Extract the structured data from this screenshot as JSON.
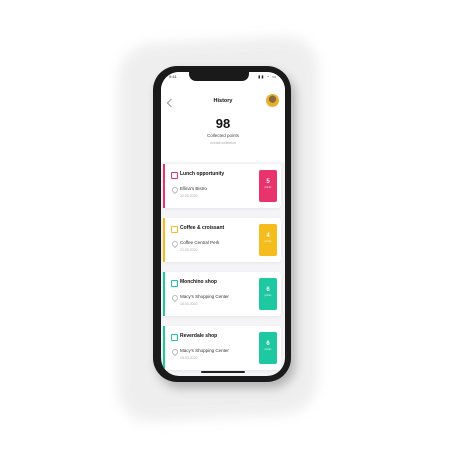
{
  "status_bar": {
    "time": "9:41",
    "icons": "▮▮ ◔ ▭"
  },
  "header": {
    "title": "History",
    "points_value": "98",
    "points_label": "Collected points",
    "points_note": "overall collection"
  },
  "cards": [
    {
      "title": "Lunch opportunity",
      "place": "Ellina's Bistro",
      "date": "22.03.2020",
      "points": "5",
      "unit": "points",
      "color": "#e8336d",
      "icon": "fork-knife-icon"
    },
    {
      "title": "Coffee & croissant",
      "place": "Coffee Central Perk",
      "date": "21.03.2020",
      "points": "4",
      "unit": "points",
      "color": "#f4bc1c",
      "icon": "coffee-cup-icon"
    },
    {
      "title": "Monchino shop",
      "place": "Macy's Shopping Center",
      "date": "18.03.2020",
      "points": "6",
      "unit": "points",
      "color": "#1ec8a0",
      "icon": "shopping-bag-icon"
    },
    {
      "title": "Reverdale shop",
      "place": "Macy's Shopping Center",
      "date": "15.03.2020",
      "points": "6",
      "unit": "points",
      "color": "#1ec8a0",
      "icon": "shopping-bag-icon"
    }
  ]
}
